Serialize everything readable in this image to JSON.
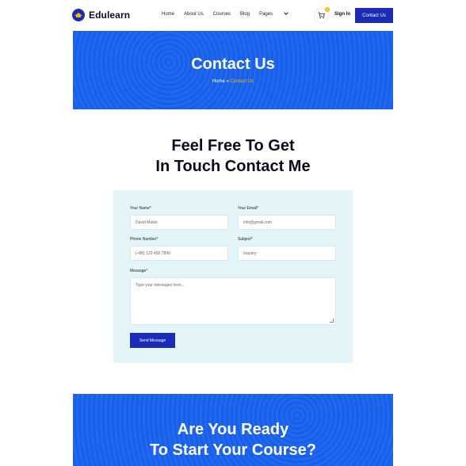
{
  "header": {
    "logo_text": "Edulearn",
    "nav": [
      {
        "label": "Home"
      },
      {
        "label": "About Us"
      },
      {
        "label": "Courses"
      },
      {
        "label": "Blog"
      },
      {
        "label": "Pages"
      }
    ],
    "cart_count": "0",
    "signin_label": "Sign In",
    "contact_button": "Contact Us"
  },
  "banner": {
    "title": "Contact Us",
    "breadcrumb_home": "Home",
    "breadcrumb_sep": "»",
    "breadcrumb_current": "Contact Us"
  },
  "heading": {
    "line1": "Feel Free To Get",
    "line2": "In Touch Contact Me"
  },
  "form": {
    "name_label": "Your Name*",
    "name_placeholder": "David Malan",
    "email_label": "Your Email*",
    "email_placeholder": "info@gmail.com",
    "phone_label": "Phone Number*",
    "phone_placeholder": "(+88) 123 456 7890",
    "subject_label": "Subject*",
    "subject_placeholder": "Inquery",
    "message_label": "Message*",
    "message_placeholder": "Type your messages here...",
    "send_label": "Send Message"
  },
  "cta": {
    "line1": "Are You Ready",
    "line2": "To Start Your Course?"
  },
  "colors": {
    "primary": "#1862ee",
    "button": "#1a2bb5",
    "accent": "#f5b800",
    "form_bg": "#e4f5fa"
  }
}
